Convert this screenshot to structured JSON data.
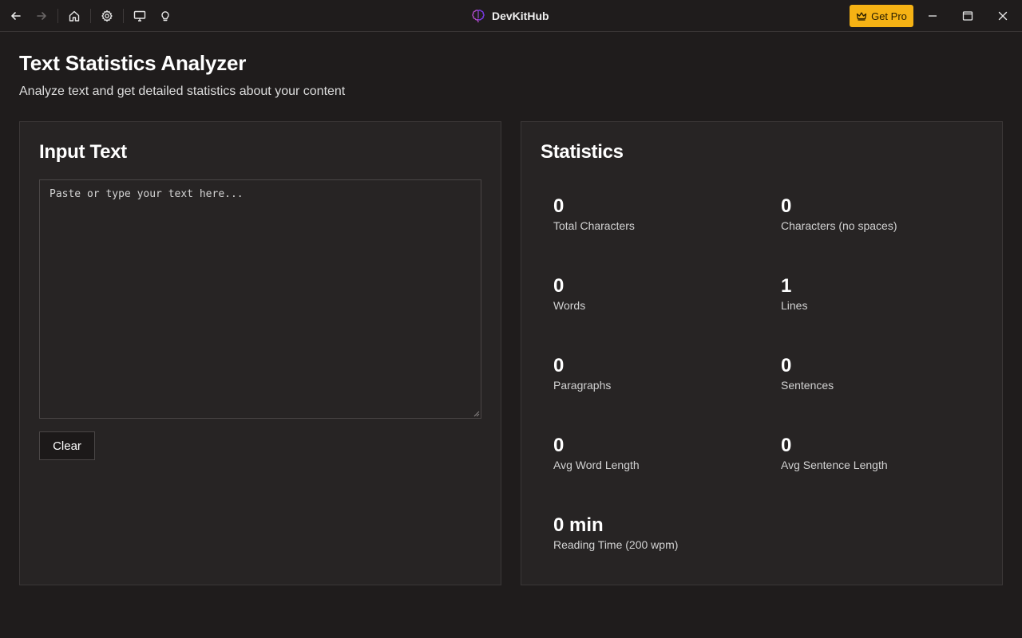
{
  "app": {
    "name": "DevKitHub",
    "get_pro_label": "Get Pro",
    "accent_color": "#f5b214"
  },
  "toolbar": {
    "icons": [
      "back-arrow-icon",
      "forward-arrow-icon",
      "home-icon",
      "gear-icon",
      "monitor-icon",
      "lightbulb-icon"
    ],
    "window_icons": [
      "minimize-icon",
      "maximize-icon",
      "close-icon"
    ]
  },
  "page": {
    "title": "Text Statistics Analyzer",
    "subtitle": "Analyze text and get detailed statistics about your content"
  },
  "input_panel": {
    "heading": "Input Text",
    "textarea_value": "",
    "textarea_placeholder": "Paste or type your text here...",
    "clear_label": "Clear"
  },
  "stats_panel": {
    "heading": "Statistics",
    "items": [
      {
        "value": "0",
        "label": "Total Characters"
      },
      {
        "value": "0",
        "label": "Characters (no spaces)"
      },
      {
        "value": "0",
        "label": "Words"
      },
      {
        "value": "1",
        "label": "Lines"
      },
      {
        "value": "0",
        "label": "Paragraphs"
      },
      {
        "value": "0",
        "label": "Sentences"
      },
      {
        "value": "0",
        "label": "Avg Word Length"
      },
      {
        "value": "0",
        "label": "Avg Sentence Length"
      },
      {
        "value": "0 min",
        "label": "Reading Time (200 wpm)"
      }
    ]
  }
}
